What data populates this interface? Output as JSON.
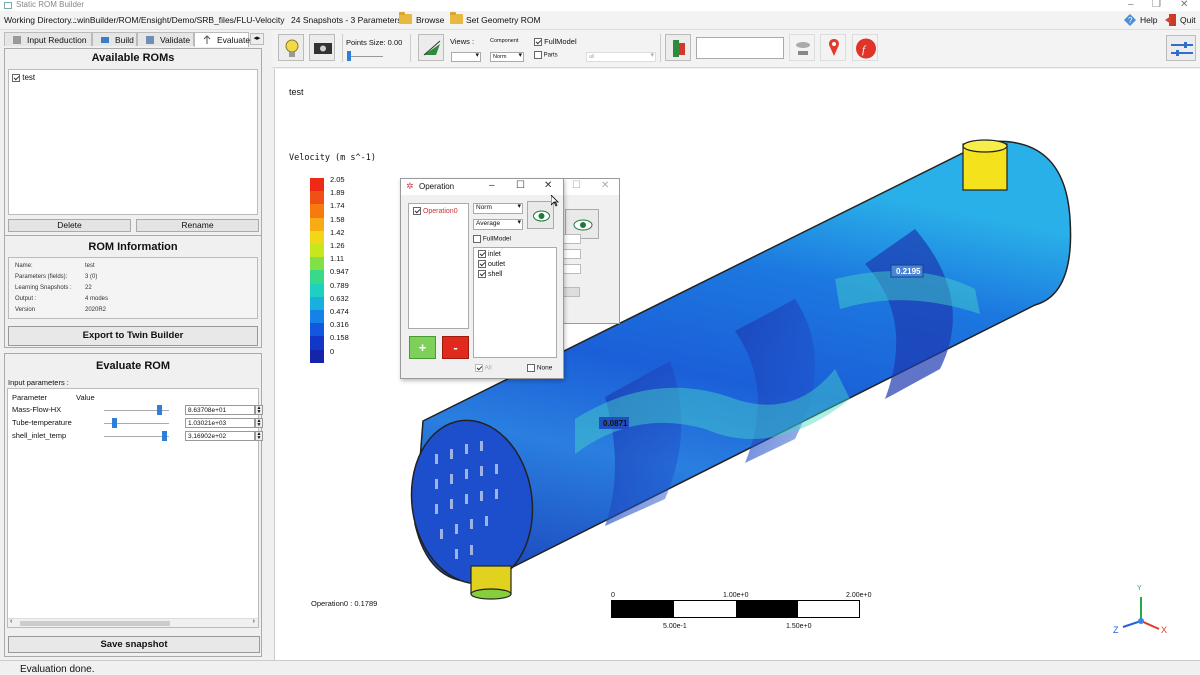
{
  "app": {
    "title": "Static ROM Builder"
  },
  "menu": {
    "working_directory_label": "Working Directory :",
    "working_directory_path": "...winBuilder/ROM/Ensight/Demo/SRB_files/FLU-Velocity",
    "snapshots_info": "24 Snapshots - 3 Parameters",
    "browse_label": "Browse",
    "set_geometry_label": "Set Geometry ROM",
    "help_label": "Help",
    "quit_label": "Quit"
  },
  "tabs": [
    {
      "label": "Input Reduction"
    },
    {
      "label": "Build"
    },
    {
      "label": "Validate"
    },
    {
      "label": "Evaluate"
    }
  ],
  "available_roms": {
    "title": "Available ROMs",
    "items": [
      {
        "label": "test",
        "checked": true
      }
    ],
    "delete_label": "Delete",
    "rename_label": "Rename"
  },
  "rom_info": {
    "title": "ROM Information",
    "rows": [
      {
        "key": "Name:",
        "value": "test"
      },
      {
        "key": "Parameters (fields):",
        "value": "3 (0)"
      },
      {
        "key": "Learning Snapshots :",
        "value": "22"
      },
      {
        "key": "Output :",
        "value": "4 modes"
      },
      {
        "key": "Version",
        "value": "2020R2"
      }
    ],
    "export_label": "Export to Twin Builder"
  },
  "evaluate_rom": {
    "title": "Evaluate ROM",
    "input_params_label": "Input parameters :",
    "col_parameter": "Parameter",
    "col_value": "Value",
    "params": [
      {
        "name": "Mass-Flow-HX",
        "value": "8.63708e+01",
        "slider": 0.85
      },
      {
        "name": "Tube-temperature",
        "value": "1.03021e+03",
        "slider": 0.13
      },
      {
        "name": "shell_inlet_temp",
        "value": "3.16902e+02",
        "slider": 0.94
      }
    ],
    "save_label": "Save snapshot"
  },
  "toolbar": {
    "points_size_label": "Points Size: 0.00",
    "views_label": "Views :",
    "component_label": "Component",
    "component_value": "Norm",
    "fullmodel_label": "FullModel",
    "parts_label": "Parts",
    "parts_value": "all"
  },
  "viewport": {
    "title": "test",
    "legend_title": "Velocity (m s^-1)",
    "legend_values": [
      "2.05",
      "1.89",
      "1.74",
      "1.58",
      "1.42",
      "1.26",
      "1.11",
      "0.947",
      "0.789",
      "0.632",
      "0.474",
      "0.316",
      "0.158",
      "0"
    ],
    "legend_colors": [
      "#ee2a15",
      "#f04f16",
      "#f67a10",
      "#f8ab13",
      "#f0d818",
      "#c8e61e",
      "#80e046",
      "#3ad98a",
      "#1ed0c0",
      "#19b0e0",
      "#1482e6",
      "#1357de",
      "#1236c8",
      "#1524a8"
    ],
    "probe_1": "0.2195",
    "probe_2": "0.0871",
    "operation_readout": "Operation0 : 0.1789",
    "scale_top": [
      "0",
      "1.00e+0",
      "2.00e+0"
    ],
    "scale_bottom": [
      "5.00e-1",
      "1.50e+0"
    ],
    "axis_z": "Z",
    "axis_x": "X",
    "axis_y": "Y"
  },
  "operation_dialog": {
    "title": "Operation",
    "items": [
      {
        "label": "Operation0",
        "checked": true
      }
    ],
    "norm_value": "Norm",
    "average_value": "Average",
    "fullmodel_label": "FullModel",
    "parts": [
      {
        "label": "inlet",
        "checked": true
      },
      {
        "label": "outlet",
        "checked": true
      },
      {
        "label": "shell",
        "checked": true
      }
    ],
    "add_label": "+",
    "remove_label": "-",
    "all_label": "All",
    "none_label": "None"
  },
  "status": {
    "message": "Evaluation done."
  }
}
